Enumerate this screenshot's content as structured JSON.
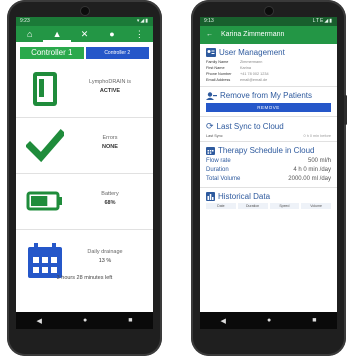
{
  "left": {
    "status_time": "9:23",
    "status_icons": "▾◢▮",
    "tabs": [
      {
        "icon": "home-icon",
        "glyph": "⌂"
      },
      {
        "icon": "bell-icon",
        "glyph": "🔔"
      },
      {
        "icon": "tools-icon",
        "glyph": "✕"
      },
      {
        "icon": "user-icon",
        "glyph": "👤"
      },
      {
        "icon": "more-icon",
        "glyph": "⋮"
      }
    ],
    "controller1": "Controller 1",
    "controller2": "Controller 2",
    "device_label": "LymphoDRAIN is",
    "device_value": "ACTIVE",
    "errors_label": "Errors",
    "errors_value": "NONE",
    "battery_label": "Battery",
    "battery_value": "68%",
    "battery_level": 0.68,
    "drainage_label": "Daily drainage",
    "drainage_value": "13 %",
    "drainage_time": "3 hours 28 minutes left"
  },
  "right": {
    "status_time": "9:13",
    "status_icons": "LTE◢▮",
    "back_glyph": "←",
    "patient_name": "Karina Zimmermann",
    "user_mgmt_title": "User Management",
    "user_fields": [
      {
        "k": "Family Name",
        "v": "Zimmermann"
      },
      {
        "k": "First Name",
        "v": "Karina"
      },
      {
        "k": "Phone Number",
        "v": "+41 78 002 1234"
      },
      {
        "k": "Email Address",
        "v": "email@email.de"
      }
    ],
    "remove_title": "Remove from My Patients",
    "remove_button": "REMOVE",
    "sync_title": "Last Sync to Cloud",
    "sync_label": "Last Sync",
    "sync_value": "0 h 0 min before",
    "therapy_title": "Therapy Schedule in Cloud",
    "flow_label": "Flow rate",
    "flow_value": "500 ml/h",
    "duration_label": "Duration",
    "duration_value": "4 h 0 min /day",
    "volume_label": "Total Volume",
    "volume_value": "2000.00 ml /day",
    "history_title": "Historical Data",
    "history_cols": [
      "Date",
      "Duration",
      "Speed",
      "Volume"
    ]
  },
  "nav": {
    "back": "◀",
    "home": "●",
    "recent": "■"
  },
  "colors": {
    "green": "#239645",
    "blue": "#2557c9",
    "icon_green": "#1f8c3b",
    "title_blue": "#2e5a9e"
  }
}
